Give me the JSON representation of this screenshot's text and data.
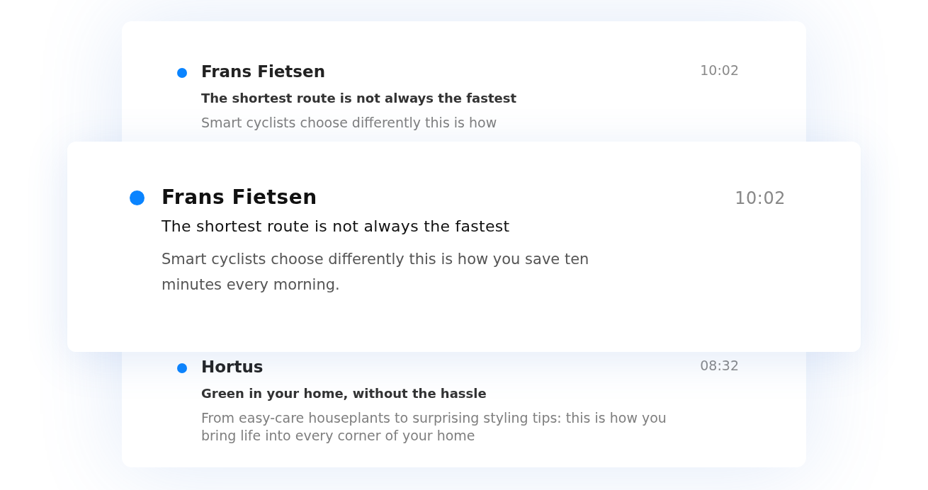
{
  "inbox": {
    "messages": [
      {
        "unread": true,
        "sender": "Frans Fietsen",
        "time": "10:02",
        "subject": "The shortest route is not always the fastest",
        "preview": "Smart cyclists choose differently this is how"
      },
      {
        "unread": true,
        "sender": "Hortus",
        "time": "08:32",
        "subject": "Green in your home, without the hassle",
        "preview": "From easy-care houseplants to surprising styling tips: this is how you bring life into every corner of your home"
      }
    ]
  },
  "highlighted": {
    "unread": true,
    "sender": "Frans Fietsen",
    "time": "10:02",
    "subject": "The shortest route is not always the fastest",
    "preview": "Smart cyclists choose differently this is how you save ten minutes every morning."
  }
}
